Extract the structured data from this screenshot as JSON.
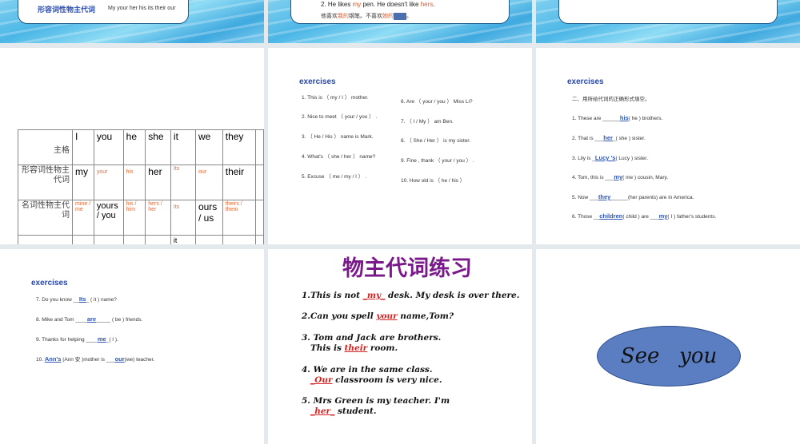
{
  "slide1": {
    "title": "形容词性物主代词",
    "words": "My   your   her    his    its   their     our"
  },
  "slide2": {
    "line1a": "2. He likes ",
    "line1b": "my",
    "line1c": " pen. He doesn't like ",
    "line1d": "hers",
    "line1e": ".",
    "line2a": "他喜欢",
    "line2b": "我的",
    "line2c": "钢笔。不喜欢",
    "line2d": "她的",
    "line2e": "。"
  },
  "table": {
    "rows": [
      {
        "head": "主格",
        "cells": [
          "I",
          "you",
          "he",
          "she",
          "it",
          "we",
          "they"
        ]
      },
      {
        "head": "形容词性物主代词",
        "cells": [
          "my",
          "your",
          "his",
          "her",
          "Its",
          "our",
          "their"
        ]
      },
      {
        "head": "名词性物主代词",
        "cells": [
          "mine / me",
          "yours / you",
          "his / him",
          "hers / her",
          "Its",
          "ours / us",
          "theirs / them"
        ]
      }
    ],
    "partial": "it"
  },
  "ex1": {
    "title": "exercises",
    "left": [
      "1.   This is  （ my / I ）  mother.",
      "2. Nice to meet  （ your / you ） .",
      "3.  （ He / His ）  name is Mark.",
      "4. What's  （ she / her ）  name?",
      "5. Excuse  （ me / my / I ）  ."
    ],
    "right": [
      "6. Are  （ your / you ）  Miss Li?",
      "7.  （ I / My ）  am Ben.",
      "8.  （ She / Her ）  is my sister.",
      "9. Fine , thank  （ your / you ）  .",
      "10. How old is  （ he / his ）"
    ]
  },
  "ex2": {
    "title": "exercises",
    "intro": "二、用所给代词的正确形式填空。",
    "items": [
      {
        "pre": "1. These are ______",
        "ans": "his",
        "post": "( he ) brothers."
      },
      {
        "pre": "2. That is ___",
        "ans": "her",
        "post": "_( she ) sister."
      },
      {
        "pre": "3. Lily is _",
        "ans": "Lucy 's",
        "post": "( Lucy ) sister."
      },
      {
        "pre": "4. Tom, this is ___",
        "ans": "my",
        "post": "( me ) cousin, Mary."
      },
      {
        "pre": "5. Now ___",
        "ans": "they",
        "post": "______(her parents)  are in America."
      },
      {
        "pre": "6. Those __",
        "ans": "children",
        "post": "( child ) are ___",
        "ans2": "my",
        "post2": "( I ) father's students."
      }
    ]
  },
  "ex3": {
    "title": "exercises",
    "items": [
      {
        "pre": "7. Do you know  __",
        "ans": "Its",
        "post": "_ ( it ) name?"
      },
      {
        "pre": "8. Mike and Tom ____",
        "ans": "are",
        "post": "_____ ( be ) friends."
      },
      {
        "pre": "9. Thanks for helping ____",
        "ans": "me",
        "post": "_( I )."
      },
      {
        "pre": "10. ",
        "ans": "Ann's",
        "post": " (Ann 安 )mother is ___",
        "ans2": "our",
        "post2": "(we) teacher."
      }
    ]
  },
  "practice": {
    "title": "物主代词练习",
    "items": [
      {
        "l1a": "1.This is not ",
        "a": "_my_",
        "l1b": " desk. My desk is over there."
      },
      {
        "l1a": "2.Can you spell ",
        "a": "your",
        "l1b": " name,Tom?"
      },
      {
        "l1a": "3. Tom and Jack are brothers.",
        "l2a": "This is ",
        "a": "their",
        "l2b": " room."
      },
      {
        "l1a": "4. We are in the same class.",
        "l2a": "",
        "a": "_Our",
        "l2b": " classroom is very nice."
      },
      {
        "l1a": "5. Mrs Green is my teacher. I'm",
        "l2a": "",
        "a": "_her_",
        "l2b": " student."
      }
    ]
  },
  "farewell": {
    "text": "See   you"
  }
}
